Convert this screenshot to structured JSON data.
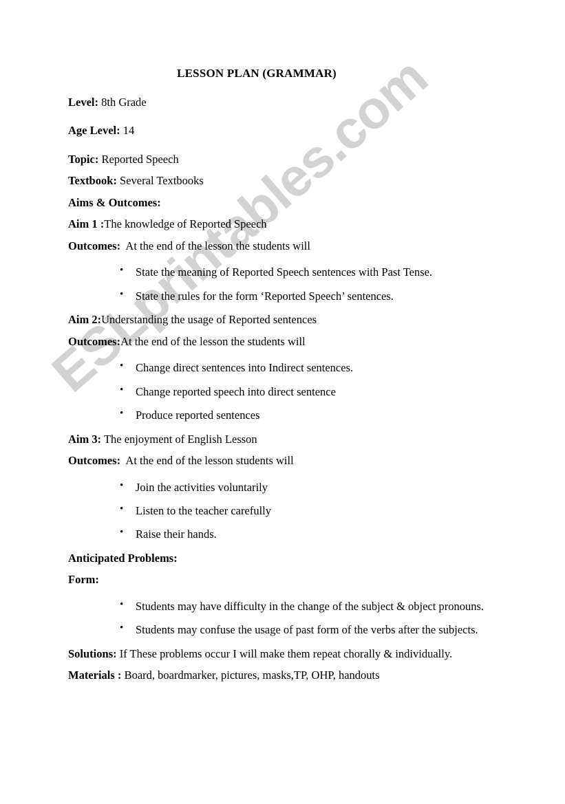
{
  "document": {
    "title": "LESSON PLAN (GRAMMAR)",
    "watermark": "ESLprintables.com",
    "watermark_color": "#d2d2d2",
    "text_color": "#000000",
    "page_background": "#ffffff"
  },
  "header_fields": [
    {
      "label": "Level:",
      "value": " 8th Grade"
    },
    {
      "label": "Age Level:",
      "value": " 14"
    },
    {
      "label": "Topic:",
      "value": " Reported Speech"
    },
    {
      "label": "Textbook:",
      "value": " Several Textbooks"
    }
  ],
  "aims_heading": "Aims & Outcomes:",
  "aims": [
    {
      "aim_label": "Aim 1 :",
      "aim_text": "The knowledge of Reported Speech",
      "outcomes_label": "Outcomes:",
      "outcomes_text": "  At the end of the lesson the students will",
      "bullets": [
        "State the meaning of Reported Speech sentences with Past Tense.",
        "State the rules for the form ‘Reported Speech’ sentences."
      ]
    },
    {
      "aim_label": "Aim 2:",
      "aim_text": "Understanding the usage of Reported sentences",
      "outcomes_label": "Outcomes:",
      "outcomes_text": "At the end of the lesson the students will",
      "bullets": [
        "Change direct sentences into Indirect sentences.",
        "Change reported speech into direct sentence",
        "Produce reported sentences"
      ]
    },
    {
      "aim_label": "Aim 3:",
      "aim_text": " The enjoyment of English Lesson",
      "outcomes_label": "Outcomes:",
      "outcomes_text": "  At the end of the lesson students will",
      "bullets": [
        "Join the activities voluntarily",
        "Listen to the teacher carefully",
        "Raise their hands."
      ]
    }
  ],
  "anticipated": {
    "heading": "Anticipated Problems:",
    "form_label": "Form:",
    "form_bullets": [
      "Students may have difficulty in the change of the subject & object pronouns.",
      "Students may confuse the usage of past form of the verbs after the subjects."
    ]
  },
  "footer_fields": [
    {
      "label": "Solutions:",
      "value": " If These problems occur I will make them repeat chorally & individually."
    },
    {
      "label": "Materials :",
      "value": " Board, boardmarker, pictures, masks,TP, OHP, handouts"
    }
  ]
}
